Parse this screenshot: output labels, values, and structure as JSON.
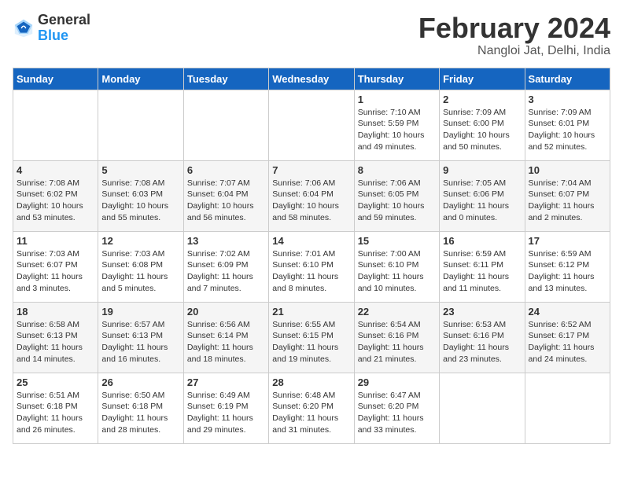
{
  "header": {
    "logo_general": "General",
    "logo_blue": "Blue",
    "month_title": "February 2024",
    "location": "Nangloi Jat, Delhi, India"
  },
  "days_of_week": [
    "Sunday",
    "Monday",
    "Tuesday",
    "Wednesday",
    "Thursday",
    "Friday",
    "Saturday"
  ],
  "weeks": [
    [
      {
        "day": "",
        "info": ""
      },
      {
        "day": "",
        "info": ""
      },
      {
        "day": "",
        "info": ""
      },
      {
        "day": "",
        "info": ""
      },
      {
        "day": "1",
        "info": "Sunrise: 7:10 AM\nSunset: 5:59 PM\nDaylight: 10 hours\nand 49 minutes."
      },
      {
        "day": "2",
        "info": "Sunrise: 7:09 AM\nSunset: 6:00 PM\nDaylight: 10 hours\nand 50 minutes."
      },
      {
        "day": "3",
        "info": "Sunrise: 7:09 AM\nSunset: 6:01 PM\nDaylight: 10 hours\nand 52 minutes."
      }
    ],
    [
      {
        "day": "4",
        "info": "Sunrise: 7:08 AM\nSunset: 6:02 PM\nDaylight: 10 hours\nand 53 minutes."
      },
      {
        "day": "5",
        "info": "Sunrise: 7:08 AM\nSunset: 6:03 PM\nDaylight: 10 hours\nand 55 minutes."
      },
      {
        "day": "6",
        "info": "Sunrise: 7:07 AM\nSunset: 6:04 PM\nDaylight: 10 hours\nand 56 minutes."
      },
      {
        "day": "7",
        "info": "Sunrise: 7:06 AM\nSunset: 6:04 PM\nDaylight: 10 hours\nand 58 minutes."
      },
      {
        "day": "8",
        "info": "Sunrise: 7:06 AM\nSunset: 6:05 PM\nDaylight: 10 hours\nand 59 minutes."
      },
      {
        "day": "9",
        "info": "Sunrise: 7:05 AM\nSunset: 6:06 PM\nDaylight: 11 hours\nand 0 minutes."
      },
      {
        "day": "10",
        "info": "Sunrise: 7:04 AM\nSunset: 6:07 PM\nDaylight: 11 hours\nand 2 minutes."
      }
    ],
    [
      {
        "day": "11",
        "info": "Sunrise: 7:03 AM\nSunset: 6:07 PM\nDaylight: 11 hours\nand 3 minutes."
      },
      {
        "day": "12",
        "info": "Sunrise: 7:03 AM\nSunset: 6:08 PM\nDaylight: 11 hours\nand 5 minutes."
      },
      {
        "day": "13",
        "info": "Sunrise: 7:02 AM\nSunset: 6:09 PM\nDaylight: 11 hours\nand 7 minutes."
      },
      {
        "day": "14",
        "info": "Sunrise: 7:01 AM\nSunset: 6:10 PM\nDaylight: 11 hours\nand 8 minutes."
      },
      {
        "day": "15",
        "info": "Sunrise: 7:00 AM\nSunset: 6:10 PM\nDaylight: 11 hours\nand 10 minutes."
      },
      {
        "day": "16",
        "info": "Sunrise: 6:59 AM\nSunset: 6:11 PM\nDaylight: 11 hours\nand 11 minutes."
      },
      {
        "day": "17",
        "info": "Sunrise: 6:59 AM\nSunset: 6:12 PM\nDaylight: 11 hours\nand 13 minutes."
      }
    ],
    [
      {
        "day": "18",
        "info": "Sunrise: 6:58 AM\nSunset: 6:13 PM\nDaylight: 11 hours\nand 14 minutes."
      },
      {
        "day": "19",
        "info": "Sunrise: 6:57 AM\nSunset: 6:13 PM\nDaylight: 11 hours\nand 16 minutes."
      },
      {
        "day": "20",
        "info": "Sunrise: 6:56 AM\nSunset: 6:14 PM\nDaylight: 11 hours\nand 18 minutes."
      },
      {
        "day": "21",
        "info": "Sunrise: 6:55 AM\nSunset: 6:15 PM\nDaylight: 11 hours\nand 19 minutes."
      },
      {
        "day": "22",
        "info": "Sunrise: 6:54 AM\nSunset: 6:16 PM\nDaylight: 11 hours\nand 21 minutes."
      },
      {
        "day": "23",
        "info": "Sunrise: 6:53 AM\nSunset: 6:16 PM\nDaylight: 11 hours\nand 23 minutes."
      },
      {
        "day": "24",
        "info": "Sunrise: 6:52 AM\nSunset: 6:17 PM\nDaylight: 11 hours\nand 24 minutes."
      }
    ],
    [
      {
        "day": "25",
        "info": "Sunrise: 6:51 AM\nSunset: 6:18 PM\nDaylight: 11 hours\nand 26 minutes."
      },
      {
        "day": "26",
        "info": "Sunrise: 6:50 AM\nSunset: 6:18 PM\nDaylight: 11 hours\nand 28 minutes."
      },
      {
        "day": "27",
        "info": "Sunrise: 6:49 AM\nSunset: 6:19 PM\nDaylight: 11 hours\nand 29 minutes."
      },
      {
        "day": "28",
        "info": "Sunrise: 6:48 AM\nSunset: 6:20 PM\nDaylight: 11 hours\nand 31 minutes."
      },
      {
        "day": "29",
        "info": "Sunrise: 6:47 AM\nSunset: 6:20 PM\nDaylight: 11 hours\nand 33 minutes."
      },
      {
        "day": "",
        "info": ""
      },
      {
        "day": "",
        "info": ""
      }
    ]
  ]
}
